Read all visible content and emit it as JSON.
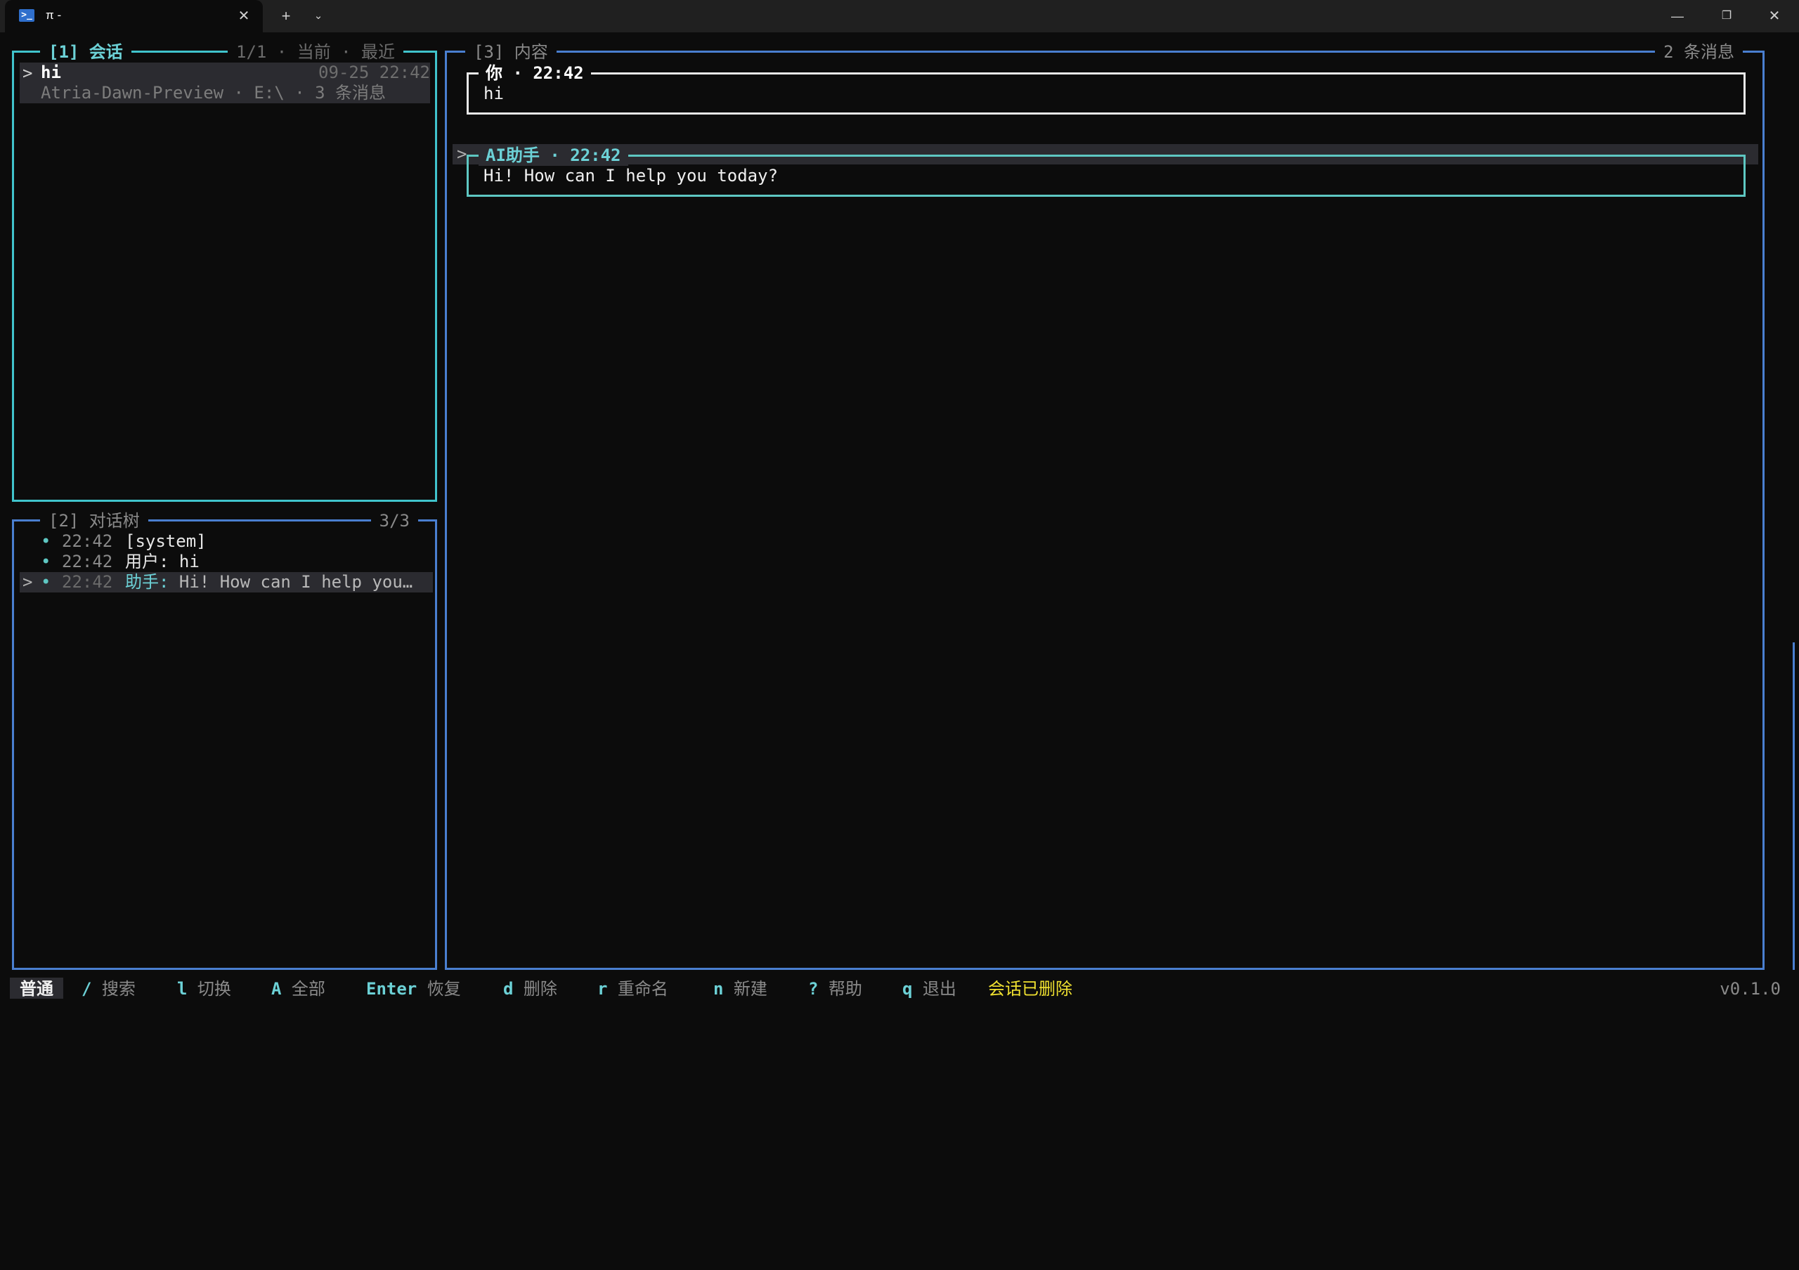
{
  "window": {
    "tab_icon": "powershell-icon",
    "tab_icon_glyph": ">_",
    "tab_title": "π -",
    "tab_close": "✕",
    "new_tab": "+",
    "tab_dropdown": "⌄",
    "minimize": "—",
    "restore": "❐",
    "close": "✕"
  },
  "sessions_panel": {
    "title": "[1] 会话",
    "title_ext": "1/1 · 当前 · 最近",
    "caret": ">",
    "item": {
      "name": "hi",
      "time": "09-25 22:42",
      "meta": "Atria-Dawn-Preview · E:\\ · 3 条消息"
    }
  },
  "tree_panel": {
    "title": "[2] 对话树",
    "count": "3/3",
    "items": [
      {
        "bullet": "•",
        "time": "22:42",
        "label": "[system]"
      },
      {
        "bullet": "•",
        "time": "22:42",
        "label": "用户: hi"
      },
      {
        "caret": ">",
        "bullet": "•",
        "time": "22:42",
        "who": "助手:",
        "label": " Hi! How can I help you…"
      }
    ]
  },
  "content_panel": {
    "title": "[3] 内容",
    "count": "2 条消息",
    "messages": [
      {
        "header": "你 · 22:42",
        "body": "hi"
      },
      {
        "caret": ">",
        "header": "AI助手 · 22:42",
        "body": "Hi! How can I help you today?"
      }
    ]
  },
  "statusbar": {
    "mode": "普通",
    "hints": [
      {
        "key": "/",
        "desc": "搜索"
      },
      {
        "key": "l",
        "desc": "切换"
      },
      {
        "key": "A",
        "desc": "全部"
      },
      {
        "key": "Enter",
        "desc": "恢复"
      },
      {
        "key": "d",
        "desc": "删除"
      },
      {
        "key": "r",
        "desc": "重命名"
      },
      {
        "key": "n",
        "desc": "新建"
      },
      {
        "key": "?",
        "desc": "帮助"
      },
      {
        "key": "q",
        "desc": "退出"
      }
    ],
    "message": "会话已删除",
    "version": "v0.1.0"
  },
  "colors": {
    "accent_cyan": "#40c4cc",
    "accent_blue": "#4a7fd0",
    "status_yellow": "#f0e130",
    "background": "#0c0c0c"
  }
}
